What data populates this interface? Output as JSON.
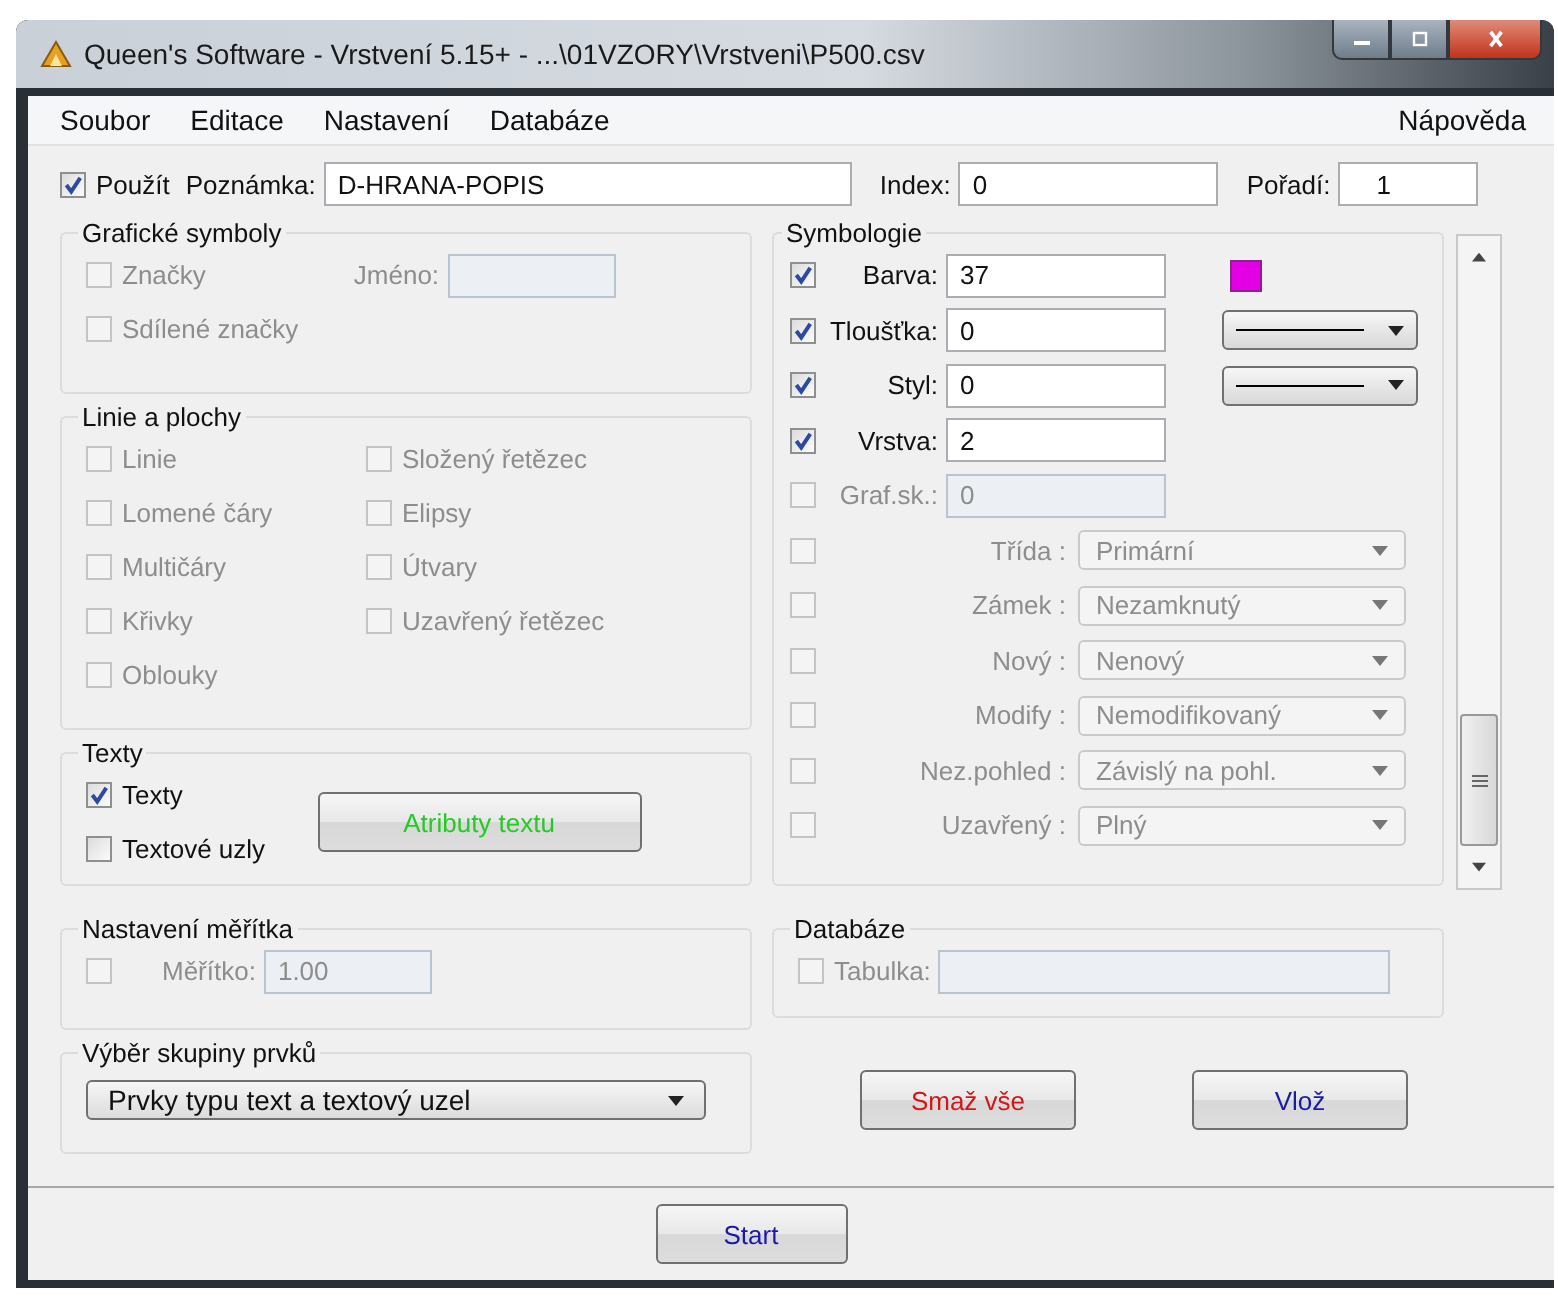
{
  "window": {
    "title": "Queen's Software - Vrstvení 5.15+ - ...\\01VZORY\\Vrstveni\\P500.csv"
  },
  "menu": {
    "left": [
      "Soubor",
      "Editace",
      "Nastavení",
      "Databáze"
    ],
    "right": [
      "Nápověda"
    ]
  },
  "top_row": {
    "use": {
      "label": "Použít",
      "checked": true
    },
    "note": {
      "label": "Poznámka:",
      "value": "D-HRANA-POPIS"
    },
    "index": {
      "label": "Index:",
      "value": "0"
    },
    "order": {
      "label": "Pořadí:",
      "value": "1"
    }
  },
  "graphic_symbols": {
    "title": "Grafické symboly",
    "items": [
      {
        "label": "Značky",
        "checked": false,
        "disabled": true
      },
      {
        "label": "Sdílené značky",
        "checked": false,
        "disabled": true
      }
    ],
    "name_field": {
      "label": "Jméno:",
      "disabled": true
    }
  },
  "lines_and_areas": {
    "title": "Linie a plochy",
    "columns": [
      [
        {
          "label": "Linie",
          "checked": false,
          "disabled": true
        },
        {
          "label": "Lomené čáry",
          "checked": false,
          "disabled": true
        },
        {
          "label": "Multičáry",
          "checked": false,
          "disabled": true
        },
        {
          "label": "Křivky",
          "checked": false,
          "disabled": true
        },
        {
          "label": "Oblouky",
          "checked": false,
          "disabled": true
        }
      ],
      [
        {
          "label": "Složený řetězec",
          "checked": false,
          "disabled": true
        },
        {
          "label": "Elipsy",
          "checked": false,
          "disabled": true
        },
        {
          "label": "Útvary",
          "checked": false,
          "disabled": true
        },
        {
          "label": "Uzavřený řetězec",
          "checked": false,
          "disabled": true
        }
      ]
    ]
  },
  "texts": {
    "title": "Texty",
    "items": [
      {
        "label": "Texty",
        "checked": true,
        "disabled": false
      },
      {
        "label": "Textové uzly",
        "checked": false,
        "disabled": false
      }
    ],
    "button": {
      "label": "Atributy textu"
    }
  },
  "symbology": {
    "title": "Symbologie",
    "rows": [
      {
        "kind": "field",
        "label": "Barva:",
        "value": "37",
        "checked": true,
        "disabled": false,
        "color": "#e400e4"
      },
      {
        "kind": "field",
        "label": "Tloušťka:",
        "value": "0",
        "checked": true,
        "disabled": false,
        "line_dropdown": true
      },
      {
        "kind": "field",
        "label": "Styl:",
        "value": "0",
        "checked": true,
        "disabled": false,
        "line_dropdown": true
      },
      {
        "kind": "field",
        "label": "Vrstva:",
        "value": "2",
        "checked": true,
        "disabled": false
      },
      {
        "kind": "field",
        "label": "Graf.sk.:",
        "value": "0",
        "checked": false,
        "disabled": true
      },
      {
        "kind": "select",
        "label": "Třída :",
        "value": "Primární",
        "checked": false,
        "disabled": true
      },
      {
        "kind": "select",
        "label": "Zámek :",
        "value": "Nezamknutý",
        "checked": false,
        "disabled": true
      },
      {
        "kind": "select",
        "label": "Nový :",
        "value": "Nenový",
        "checked": false,
        "disabled": true
      },
      {
        "kind": "select",
        "label": "Modify :",
        "value": "Nemodifikovaný",
        "checked": false,
        "disabled": true
      },
      {
        "kind": "select",
        "label": "Nez.pohled :",
        "value": "Závislý na pohl.",
        "checked": false,
        "disabled": true
      },
      {
        "kind": "select",
        "label": "Uzavřený :",
        "value": "Plný",
        "checked": false,
        "disabled": true
      }
    ]
  },
  "scale": {
    "title": "Nastavení měřítka",
    "checked": false,
    "field": {
      "label": "Měřítko:",
      "value": "1.00",
      "disabled": true
    }
  },
  "database": {
    "title": "Databáze",
    "checked": false,
    "field": {
      "label": "Tabulka:",
      "disabled": true
    }
  },
  "group_select": {
    "title": "Výběr skupiny prvků",
    "value": "Prvky typu text a textový uzel"
  },
  "buttons": [
    {
      "label": "Smaž vše",
      "color": "#d01818"
    },
    {
      "label": "Vlož",
      "color": "#1a1aa8"
    }
  ],
  "start_button": {
    "label": "Start"
  }
}
